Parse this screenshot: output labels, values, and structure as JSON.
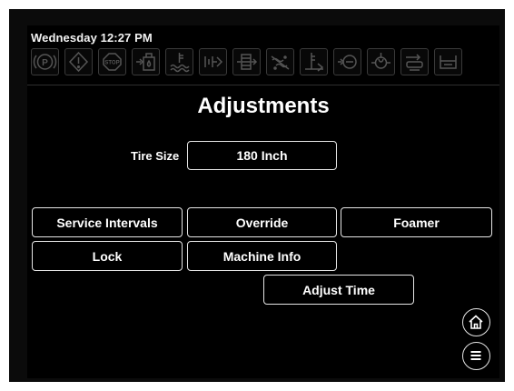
{
  "header": {
    "datetime": "Wednesday 12:27 PM"
  },
  "indicators": [
    "park-brake-icon",
    "warning-icon",
    "stop-icon",
    "hydraulic-oil-icon",
    "coolant-level-icon",
    "transmission-icon",
    "filter-icon",
    "dpf-icon",
    "fuel-level-icon",
    "oil-pressure-icon",
    "oil-filter-icon",
    "hitch-icon",
    "fluid-tank-icon"
  ],
  "page": {
    "title": "Adjustments"
  },
  "tire": {
    "label": "Tire Size",
    "value": "180 Inch"
  },
  "menu": {
    "service_intervals": "Service Intervals",
    "override": "Override",
    "foamer": "Foamer",
    "lock": "Lock",
    "machine_info": "Machine Info",
    "adjust_time": "Adjust Time"
  },
  "colors": {
    "background": "#000000",
    "text": "#ffffff",
    "button_border": "#e6e6e6",
    "indicator_border": "#3a3a3a"
  }
}
